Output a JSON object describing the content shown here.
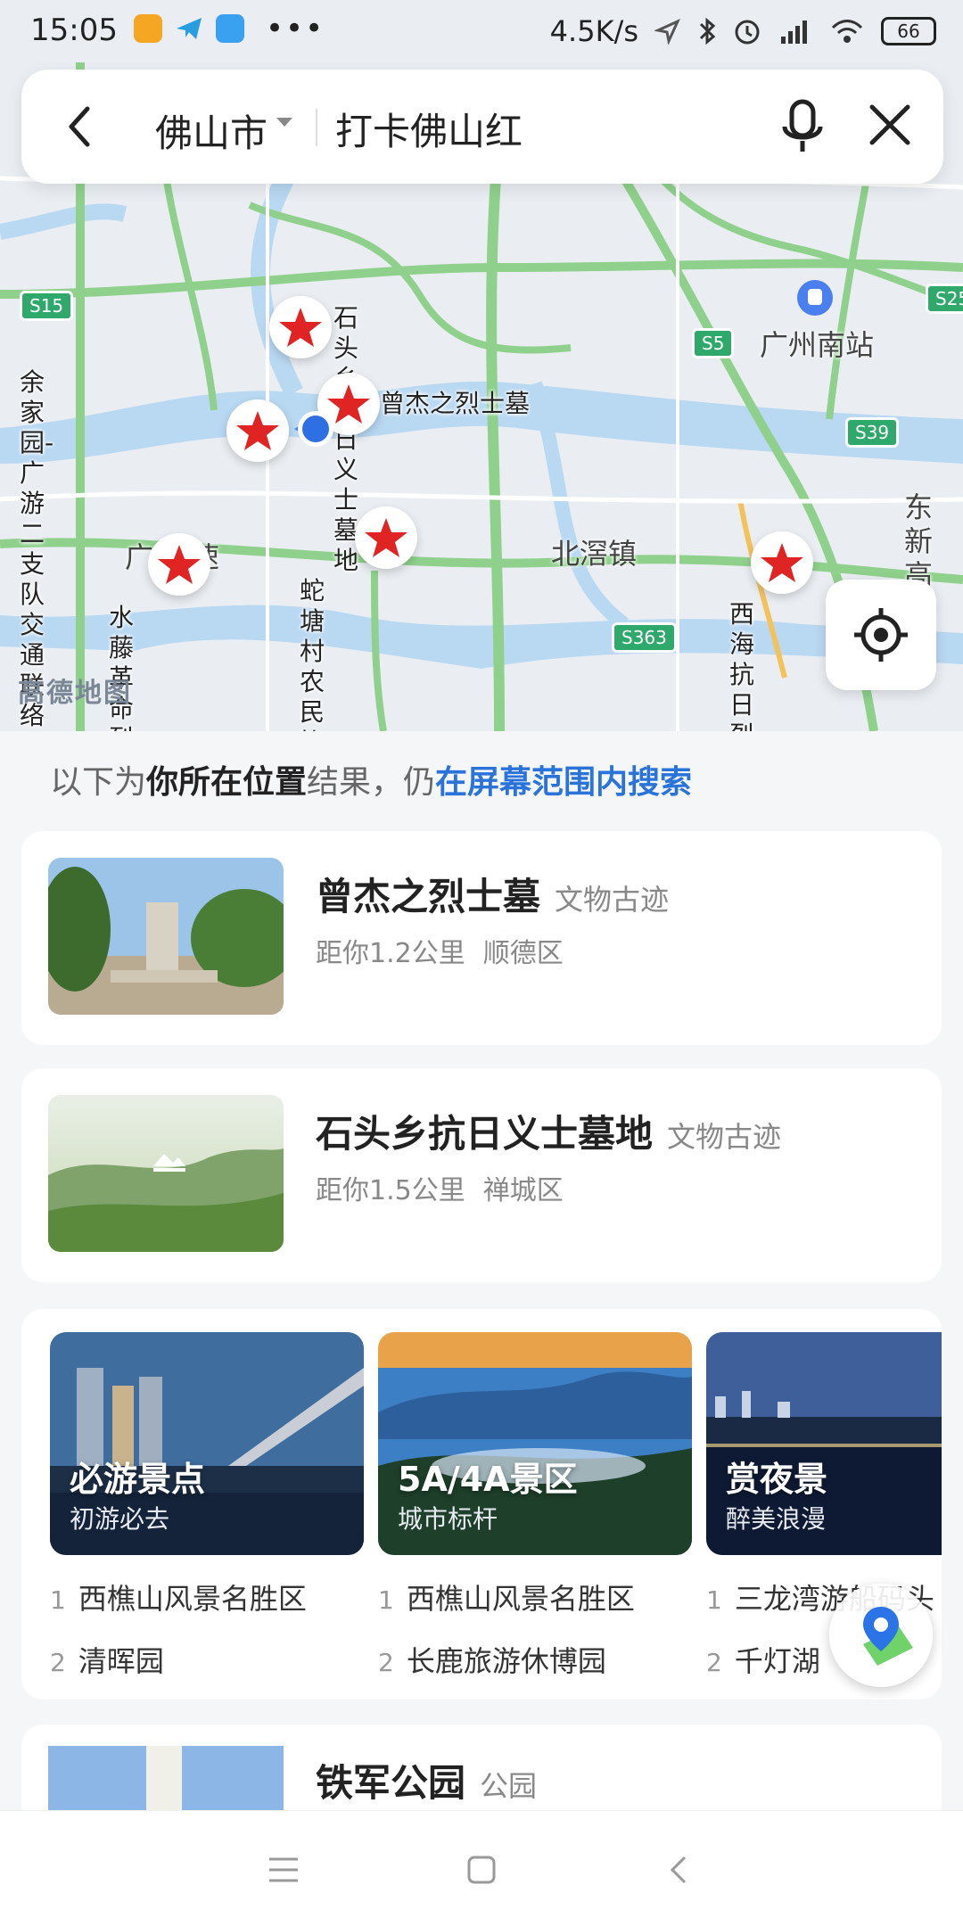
{
  "status_bar": {
    "time": "15:05",
    "net_speed": "4.5K/s",
    "battery": "66"
  },
  "search": {
    "city": "佛山市",
    "query": "打卡佛山红"
  },
  "map": {
    "logo": "高德地图",
    "pois": [
      {
        "label": "石头乡抗日\n义士墓地"
      },
      {
        "label": "曾杰之烈士墓"
      },
      {
        "label": "余家园-广游二\n支队交通联络站\n旧址中共地下黄\n连支部驻地旧址"
      },
      {
        "label": "水藤革命烈\n士纪念碑"
      },
      {
        "label": "蛇塘村农民协\n会成立旧址"
      },
      {
        "label": "西海抗日\n烈士陵园"
      }
    ],
    "places": {
      "guangzhou_south": "广州南站",
      "beijiao": "北滘镇",
      "guang_high": "广  高速",
      "dongxin": "东\n新\n高"
    },
    "road_tags": [
      "S15",
      "S5",
      "S39",
      "S363",
      "S25"
    ]
  },
  "hint": {
    "prefix": "以下为",
    "bold": "你所在位置",
    "middle": "结果，仍",
    "link": "在屏幕范围内搜索"
  },
  "results": [
    {
      "title": "曾杰之烈士墓",
      "type": "文物古迹",
      "distance": "距你1.2公里",
      "district": "顺德区"
    },
    {
      "title": "石头乡抗日义士墓地",
      "type": "文物古迹",
      "distance": "距你1.5公里",
      "district": "禅城区"
    }
  ],
  "recommend": [
    {
      "title": "必游景点",
      "subtitle": "初游必去",
      "items": [
        {
          "n": "1",
          "name": "西樵山风景名胜区"
        },
        {
          "n": "2",
          "name": "清晖园"
        }
      ]
    },
    {
      "title": "5A/4A景区",
      "subtitle": "城市标杆",
      "items": [
        {
          "n": "1",
          "name": "西樵山风景名胜区"
        },
        {
          "n": "2",
          "name": "长鹿旅游休博园"
        }
      ]
    },
    {
      "title": "赏夜景",
      "subtitle": "醉美浪漫",
      "items": [
        {
          "n": "1",
          "name": "三龙湾游船码头"
        },
        {
          "n": "2",
          "name": "千灯湖"
        }
      ]
    }
  ],
  "partial_result": {
    "title": "铁军公园",
    "type": "公园"
  }
}
